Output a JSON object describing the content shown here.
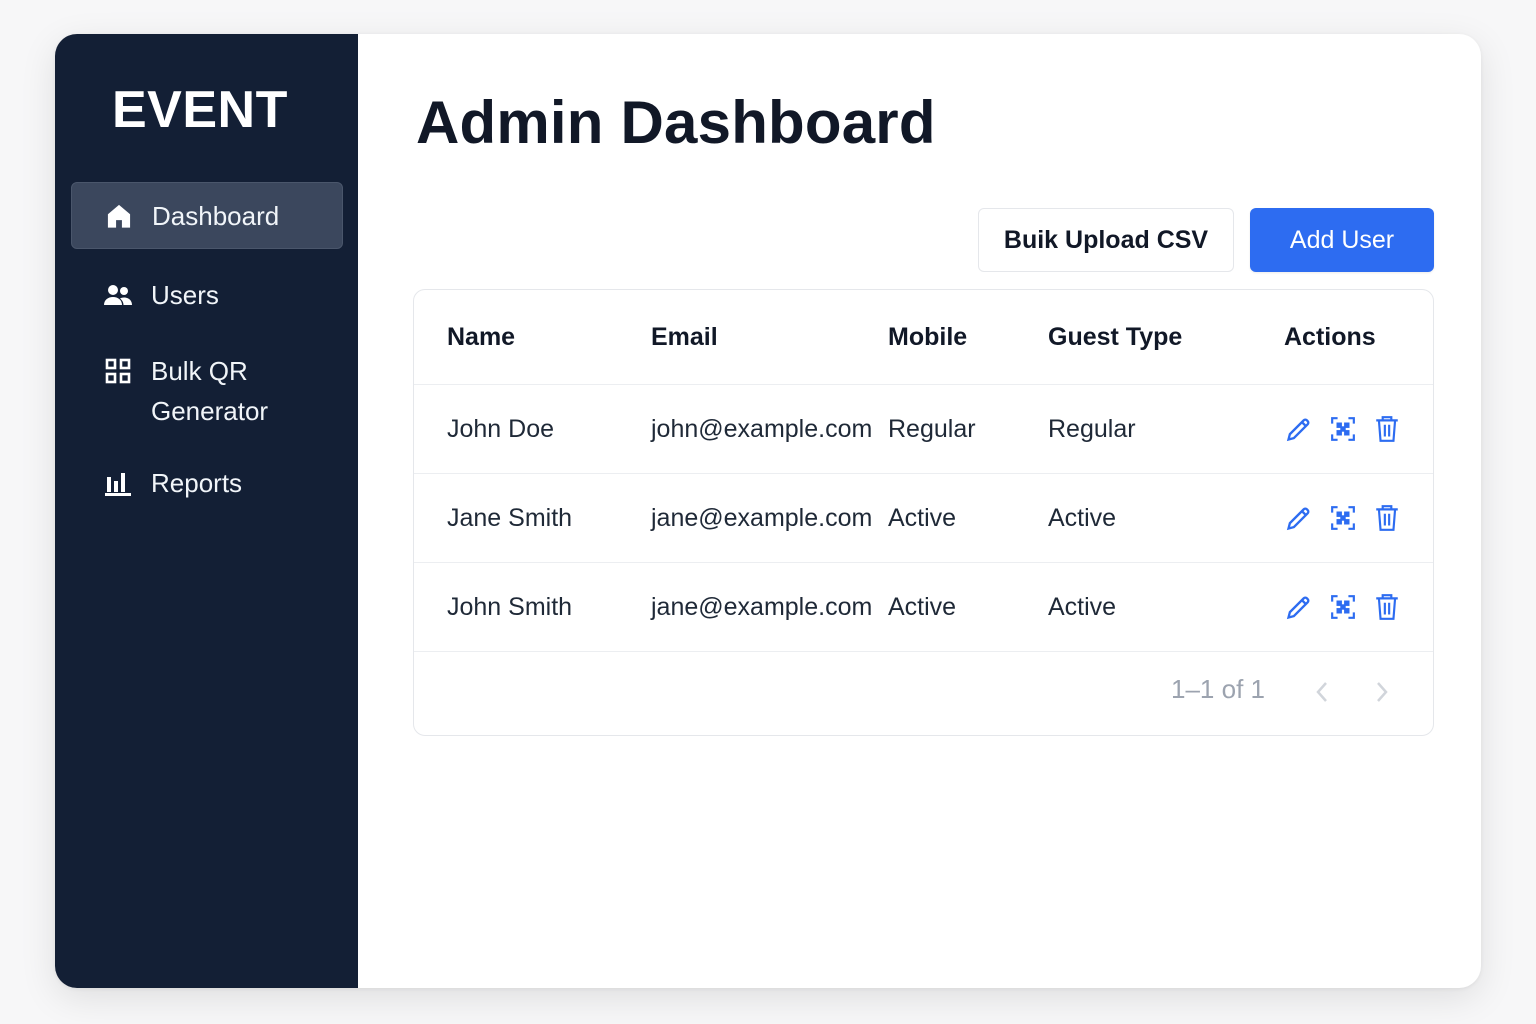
{
  "sidebar": {
    "brand": "EVENT",
    "items": [
      {
        "label": "Dashboard",
        "icon": "home-icon",
        "active": true
      },
      {
        "label": "Users",
        "icon": "users-icon",
        "active": false
      },
      {
        "label": "Bulk QR\nGenerator",
        "icon": "grid-icon",
        "active": false
      },
      {
        "label": "Reports",
        "icon": "bar-chart-icon",
        "active": false
      }
    ]
  },
  "main": {
    "title": "Admin Dashboard",
    "buttons": {
      "bulk_upload": "Buik Upload CSV",
      "add_user": "Add User"
    },
    "table": {
      "columns": [
        "Name",
        "Email",
        "Mobile",
        "Guest Type",
        "Actions"
      ],
      "rows": [
        {
          "name": "John Doe",
          "email": "john@example.com",
          "mobile": "Regular",
          "guest_type": "Regular"
        },
        {
          "name": "Jane Smith",
          "email": "jane@example.com",
          "mobile": "Active",
          "guest_type": "Active"
        },
        {
          "name": "John Smith",
          "email": "jane@example.com",
          "mobile": "Active",
          "guest_type": "Active"
        }
      ],
      "action_icons": [
        "edit-icon",
        "qr-code-icon",
        "trash-icon"
      ]
    },
    "pagination": {
      "text": "1–1 of 1"
    }
  },
  "colors": {
    "sidebar_bg": "#131f35",
    "sidebar_active_bg": "#3b475d",
    "accent": "#2d6cf1",
    "muted_text": "#9ca3af"
  }
}
